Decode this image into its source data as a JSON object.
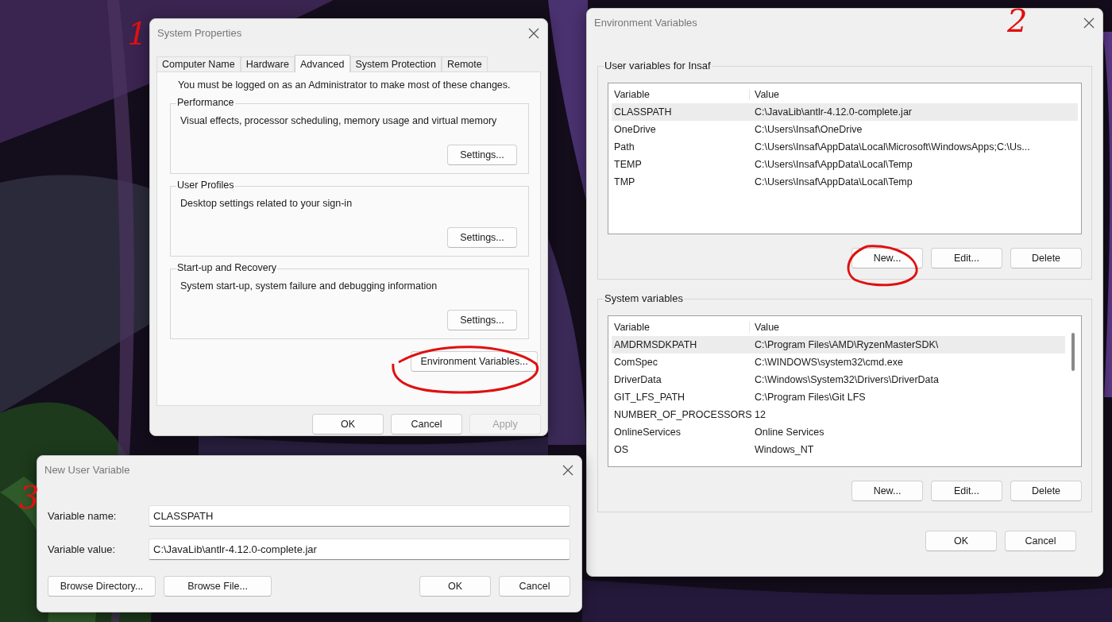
{
  "system_properties": {
    "title": "System Properties",
    "tabs": [
      {
        "label": "Computer Name",
        "selected": false
      },
      {
        "label": "Hardware",
        "selected": false
      },
      {
        "label": "Advanced",
        "selected": true
      },
      {
        "label": "System Protection",
        "selected": false
      },
      {
        "label": "Remote",
        "selected": false
      }
    ],
    "notice": "You must be logged on as an Administrator to make most of these changes.",
    "groups": [
      {
        "title": "Performance",
        "description": "Visual effects, processor scheduling, memory usage and virtual memory",
        "button": "Settings..."
      },
      {
        "title": "User Profiles",
        "description": "Desktop settings related to your sign-in",
        "button": "Settings..."
      },
      {
        "title": "Start-up and Recovery",
        "description": "System start-up, system failure and debugging information",
        "button": "Settings..."
      }
    ],
    "env_button": "Environment Variables...",
    "buttons": [
      {
        "label": "OK",
        "disabled": false
      },
      {
        "label": "Cancel",
        "disabled": false
      },
      {
        "label": "Apply",
        "disabled": true
      }
    ]
  },
  "environment_variables": {
    "title": "Environment Variables",
    "user_group": {
      "title": "User variables for Insaf",
      "columns": [
        "Variable",
        "Value"
      ],
      "rows": [
        {
          "variable": "CLASSPATH",
          "value": "C:\\JavaLib\\antlr-4.12.0-complete.jar",
          "selected": true
        },
        {
          "variable": "OneDrive",
          "value": "C:\\Users\\Insaf\\OneDrive",
          "selected": false
        },
        {
          "variable": "Path",
          "value": "C:\\Users\\Insaf\\AppData\\Local\\Microsoft\\WindowsApps;C:\\Us...",
          "selected": false
        },
        {
          "variable": "TEMP",
          "value": "C:\\Users\\Insaf\\AppData\\Local\\Temp",
          "selected": false
        },
        {
          "variable": "TMP",
          "value": "C:\\Users\\Insaf\\AppData\\Local\\Temp",
          "selected": false
        }
      ],
      "buttons": [
        "New...",
        "Edit...",
        "Delete"
      ]
    },
    "system_group": {
      "title": "System variables",
      "columns": [
        "Variable",
        "Value"
      ],
      "rows": [
        {
          "variable": "AMDRMSDKPATH",
          "value": "C:\\Program Files\\AMD\\RyzenMasterSDK\\",
          "selected": true
        },
        {
          "variable": "ComSpec",
          "value": "C:\\WINDOWS\\system32\\cmd.exe",
          "selected": false
        },
        {
          "variable": "DriverData",
          "value": "C:\\Windows\\System32\\Drivers\\DriverData",
          "selected": false
        },
        {
          "variable": "GIT_LFS_PATH",
          "value": "C:\\Program Files\\Git LFS",
          "selected": false
        },
        {
          "variable": "NUMBER_OF_PROCESSORS",
          "value": "12",
          "selected": false
        },
        {
          "variable": "OnlineServices",
          "value": "Online Services",
          "selected": false
        },
        {
          "variable": "OS",
          "value": "Windows_NT",
          "selected": false
        }
      ],
      "buttons": [
        "New...",
        "Edit...",
        "Delete"
      ]
    },
    "buttons": [
      "OK",
      "Cancel"
    ]
  },
  "new_user_variable": {
    "title": "New User Variable",
    "fields": [
      {
        "label": "Variable name:",
        "value": "CLASSPATH"
      },
      {
        "label": "Variable value:",
        "value": "C:\\JavaLib\\antlr-4.12.0-complete.jar"
      }
    ],
    "buttons": [
      "Browse Directory...",
      "Browse File...",
      "OK",
      "Cancel"
    ]
  },
  "annotations": [
    "1",
    "2",
    "3"
  ]
}
